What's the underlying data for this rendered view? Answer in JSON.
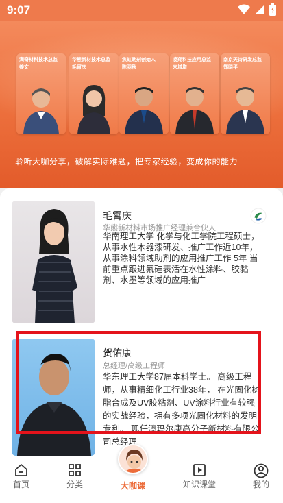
{
  "status_bar": {
    "time": "9:07"
  },
  "hero": {
    "experts": [
      {
        "caption_line1": "满奇材料技术总监",
        "caption_line2": "姜文"
      },
      {
        "caption_line1": "华熊新材技术总监",
        "caption_line2": "毛宵庆"
      },
      {
        "caption_line1": "焦虹助剂创始人",
        "caption_line2": "陈羽秋"
      },
      {
        "caption_line1": "凌翔科技应用总监",
        "caption_line2": "宋增增"
      },
      {
        "caption_line1": "南京天诗研发总监",
        "caption_line2": "郑晓平"
      }
    ],
    "tagline": "聆听大咖分享，破解实际难题，把专家经验，变成你的能力"
  },
  "experts": [
    {
      "name": "毛霄庆",
      "title": "华熊新材料市场推广经理兼合伙人",
      "bio": "华南理工大学 化学与化工学院工程硕士，从事水性木器漆研发、推广工作近10年，从事涂料领域助剂的应用推广工作 5年 当前重点跟进氟硅表活在水性涂料、胶黏剂、水墨等领域的应用推广"
    },
    {
      "name": "贺佑康",
      "title": "总经理/高级工程师",
      "bio": "华东理工大学87届本科学士。 高级工程师，从事精细化工行业38年， 在光固化树脂合成及UV胶粘剂、UV涂料行业有较强的实战经验，拥有多项光固化材料的发明专利。 现任澳玛尔康高分子新材料有限公司总经理"
    }
  ],
  "tabs": [
    {
      "label": "首页",
      "icon": "home-icon"
    },
    {
      "label": "分类",
      "icon": "grid-icon"
    },
    {
      "label": "大咖课",
      "icon": "avatar-icon"
    },
    {
      "label": "知识课堂",
      "icon": "play-icon"
    },
    {
      "label": "我的",
      "icon": "person-icon"
    }
  ],
  "colors": {
    "accent": "#ec6c3a",
    "highlight": "#e4131b"
  }
}
